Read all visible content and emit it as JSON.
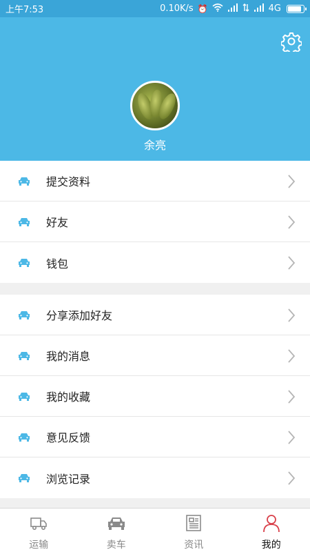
{
  "status_bar": {
    "time": "上午7:53",
    "net_speed": "0.10K/s",
    "network_type": "4G",
    "battery_level_percent": 90
  },
  "profile": {
    "username": "余亮",
    "settings_icon": "gear-icon",
    "header_color": "#4cb8e6"
  },
  "menu_group_1": [
    {
      "label": "提交资料",
      "icon": "car-icon"
    },
    {
      "label": "好友",
      "icon": "car-icon"
    },
    {
      "label": "钱包",
      "icon": "car-icon"
    }
  ],
  "menu_group_2": [
    {
      "label": "分享添加好友",
      "icon": "car-icon"
    },
    {
      "label": "我的消息",
      "icon": "car-icon"
    },
    {
      "label": "我的收藏",
      "icon": "car-icon"
    },
    {
      "label": "意见反馈",
      "icon": "car-icon"
    },
    {
      "label": "浏览记录",
      "icon": "car-icon"
    }
  ],
  "tabs": [
    {
      "label": "运输",
      "icon": "truck-icon",
      "active": false
    },
    {
      "label": "卖车",
      "icon": "car-icon",
      "active": false
    },
    {
      "label": "资讯",
      "icon": "news-icon",
      "active": false
    },
    {
      "label": "我的",
      "icon": "person-icon",
      "active": true
    }
  ],
  "colors": {
    "accent": "#4cb8e6",
    "row_icon": "#4cb8e6",
    "active_tab_icon": "#d9404a"
  }
}
